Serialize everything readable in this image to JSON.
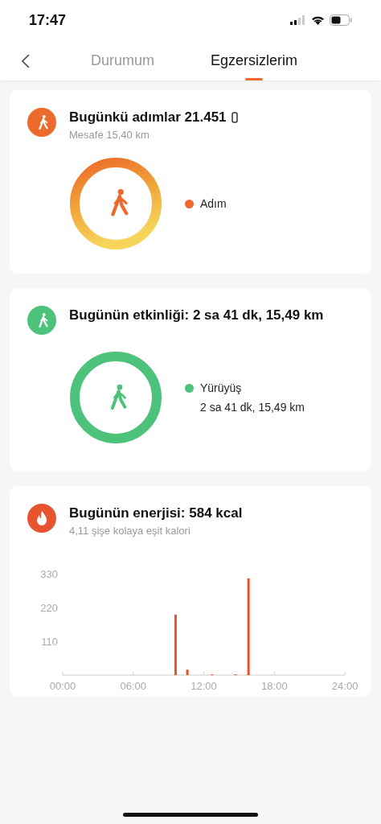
{
  "status_bar": {
    "time": "17:47"
  },
  "nav": {
    "tabs": [
      {
        "label": "Durumum",
        "selected": false
      },
      {
        "label": "Egzersizlerim",
        "selected": true
      }
    ]
  },
  "cards": [
    {
      "kind": "steps",
      "title": "Bugünkü adımlar 21.451",
      "subtitle": "Mesafe 15,40 km",
      "legend": [
        {
          "label": "Adım",
          "color": "#ec6a2c"
        }
      ]
    },
    {
      "kind": "activity",
      "title": "Bugünün etkinliği: 2 sa 41 dk, 15,49 km",
      "legend": [
        {
          "label": "Yürüyüş",
          "detail": "2 sa 41 dk, 15,49 km",
          "color": "#4cc27a"
        }
      ]
    },
    {
      "kind": "energy",
      "title": "Bugünün enerjisi: 584 kcal",
      "subtitle": "4,11 şişe kolaya eşit kalori",
      "chart_data": {
        "type": "bar",
        "x": [
          9.6,
          10.6,
          12.7,
          14.7,
          15.8
        ],
        "values": [
          197,
          18,
          2,
          2,
          315
        ],
        "xlim": [
          0,
          24
        ],
        "ylim": [
          0,
          330
        ],
        "xticks": [
          {
            "value": 0,
            "label": "00:00"
          },
          {
            "value": 6,
            "label": "06:00"
          },
          {
            "value": 12,
            "label": "12:00"
          },
          {
            "value": 18,
            "label": "18:00"
          },
          {
            "value": 24,
            "label": "24:00"
          }
        ],
        "yticks": [
          110,
          220,
          330
        ]
      }
    }
  ]
}
